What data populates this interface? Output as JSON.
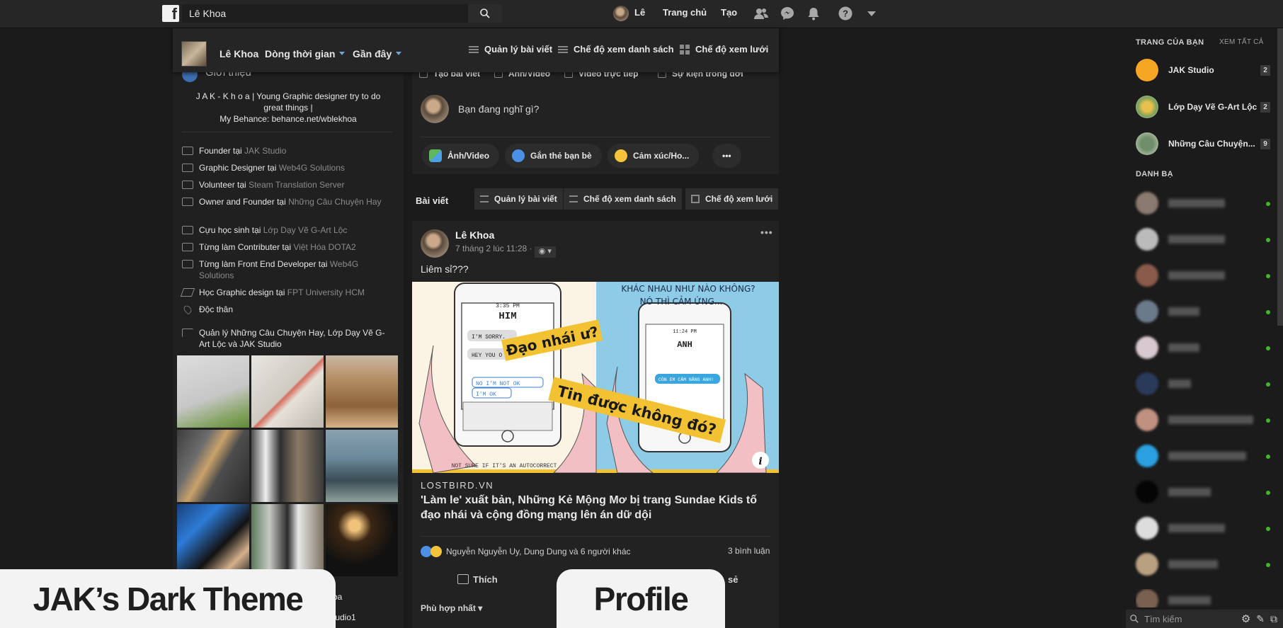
{
  "topbar": {
    "search_value": "Lê Khoa",
    "profile_name": "Lê",
    "home": "Trang chủ",
    "create": "Tạo"
  },
  "subnav": {
    "name": "Lê Khoa",
    "timeline": "Dòng thời gian",
    "recent": "Gần đây",
    "manage_posts": "Quản lý bài viết",
    "list_view": "Chế độ xem danh sách",
    "grid_view": "Chế độ xem lưới"
  },
  "intro": {
    "title": "Giới thiệu",
    "bio_line1": "J A K - K h o a | Young Graphic designer try to do",
    "bio_line2": "great things |",
    "bio_line3": "My Behance: behance.net/wblekhoa",
    "rows": [
      {
        "prefix": "Founder tại ",
        "link": "JAK Studio"
      },
      {
        "prefix": "Graphic Designer tại ",
        "link": "Web4G Solutions"
      },
      {
        "prefix": "Volunteer tại ",
        "link": "Steam Translation Server"
      },
      {
        "prefix": "Owner and Founder tại ",
        "link": "Những Câu Chuyện Hay"
      },
      {
        "prefix": "Cựu học sinh tại ",
        "link": "Lớp Dạy Vẽ G-Art Lộc"
      },
      {
        "prefix": "Từng làm Contributer tại ",
        "link": "Việt Hóa DOTA2"
      },
      {
        "prefix": "Từng làm Front End Developer tại ",
        "link": "Web4G Solutions"
      },
      {
        "prefix": "Học Graphic design tại ",
        "link": "FPT University HCM"
      },
      {
        "prefix": "Độc thân",
        "link": ""
      },
      {
        "prefix": "Quản lý Những Câu Chuyện Hay, Lớp Dạy Vẽ G-Art Lộc và JAK Studio",
        "link": ""
      }
    ],
    "bottom_partial_1": "oa",
    "bottom_partial_2": "tudio1"
  },
  "composer": {
    "tab_create": "Tạo bài viết",
    "tab_photo": "Ảnh/Video",
    "tab_live": "Video trực tiếp",
    "tab_event": "Sự kiện trong đời",
    "placeholder": "Bạn đang nghĩ gì?",
    "photo_btn": "Ảnh/Video",
    "tag_btn": "Gắn thẻ bạn bè",
    "feeling_btn": "Cảm xúc/Ho...",
    "more_btn": "•••"
  },
  "postbar": {
    "label": "Bài viết",
    "manage": "Quản lý bài viết",
    "list": "Chế độ xem danh sách",
    "grid": "Chế độ xem lưới"
  },
  "post": {
    "author": "Lê Khoa",
    "time": "7 tháng 2 lúc 11:28 ·",
    "text": "Liêm sỉ???",
    "image_text_1": "Đạo nhái ư?",
    "image_text_2": "Tin được không đó?",
    "image_heading": "KHÁC NHAU NHƯ NÀO KHÔNG?",
    "image_heading_2": "NÓ THÌ CẢM ỨNG...",
    "image_footer": "NOT SURE IF IT'S AN AUTOCORRECT",
    "phone_left_name": "HIM",
    "phone_left_time": "3:35 PM",
    "phone_right_name": "ANH",
    "phone_right_time": "11:24 PM",
    "bubble_1": "I'M SORRY.",
    "bubble_2": "HEY YOU O",
    "bubble_3": "NO I'M NOT OK",
    "bubble_4": "I'M OK",
    "bubble_5": "CÒN EM CẢM NẮNG ANH!",
    "link_domain": "LOSTBIRD.VN",
    "link_title": "'Làm le' xuất bản, Những Kẻ Mộng Mơ bị trang Sundae Kids tố đạo nhái và cộng đồng mạng lên án dữ dội",
    "reactions": "Nguyễn Nguyễn Uy, Dung Dung và 6 người khác",
    "comments": "3 bình luận",
    "like": "Thích",
    "share_partial": "sẻ",
    "sort": "Phù hợp nhất"
  },
  "sidebar": {
    "pages_heading": "TRANG CỦA BẠN",
    "see_all": "XEM TẤT CẢ",
    "pages": [
      {
        "name": "JAK Studio",
        "badge": "2"
      },
      {
        "name": "Lớp Dạy Vẽ G-Art Lộc",
        "badge": "2"
      },
      {
        "name": "Những Câu Chuyện...",
        "badge": "9"
      }
    ],
    "contacts_heading": "DANH BẠ",
    "chat_search": "Tìm kiếm"
  },
  "overlay": {
    "left": "JAK’s Dark Theme",
    "right": "Profile"
  }
}
